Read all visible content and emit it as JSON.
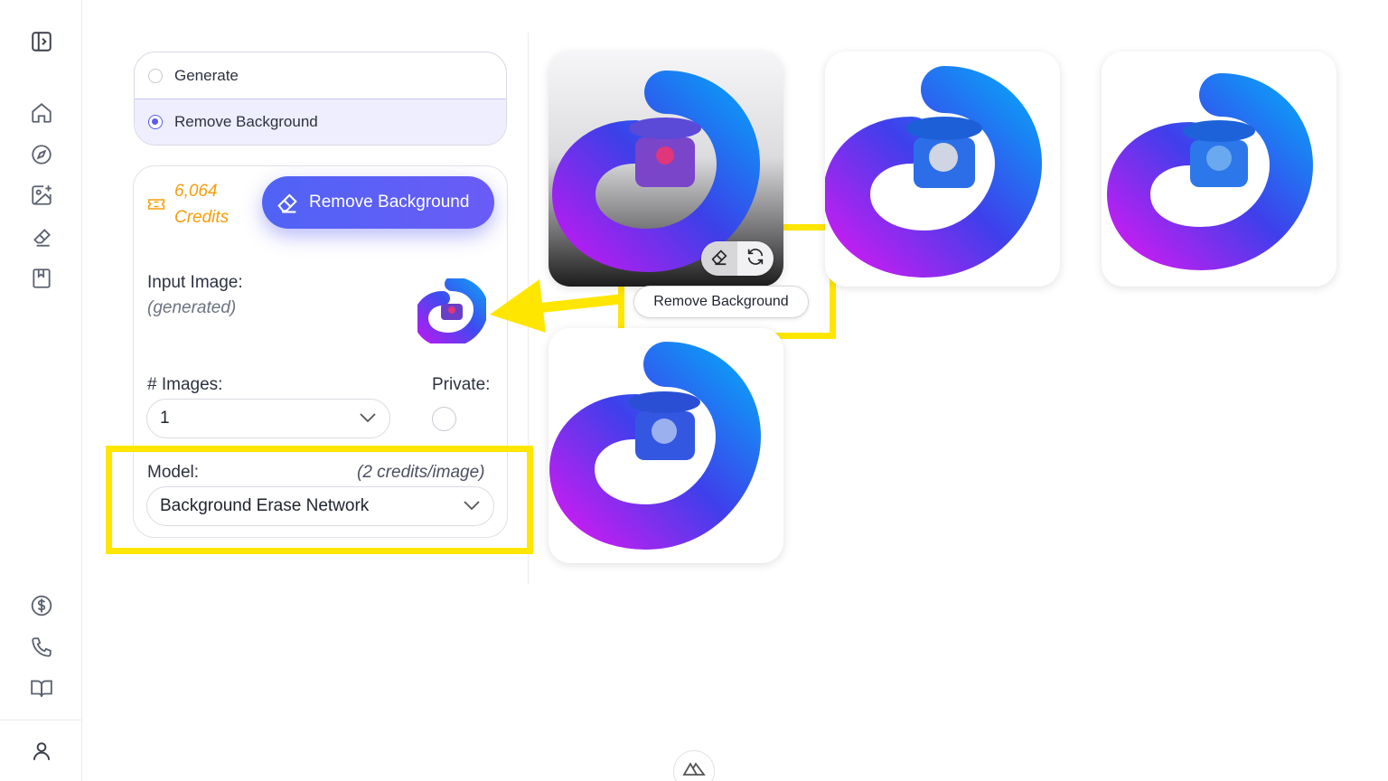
{
  "mode": {
    "options": [
      {
        "label": "Generate",
        "selected": false
      },
      {
        "label": "Remove Background",
        "selected": true
      }
    ]
  },
  "credits": {
    "amount": "6,064",
    "label": "Credits"
  },
  "action_button": {
    "label": "Remove Background"
  },
  "input_image": {
    "label": "Input Image:",
    "note": "(generated)"
  },
  "images_count": {
    "label": "# Images:",
    "value": "1"
  },
  "private": {
    "label": "Private:",
    "checked": false
  },
  "model": {
    "label": "Model:",
    "cost": "(2 credits/image)",
    "value": "Background Erase Network"
  },
  "tooltip": {
    "text": "Remove Background"
  },
  "colors": {
    "accent": "#5b5bf0",
    "credits": "#f59e0b",
    "highlight": "#ffe600"
  },
  "icons": [
    "sidebar-toggle-icon",
    "home-icon",
    "compass-icon",
    "image-add-icon",
    "eraser-icon",
    "bookmark-icon",
    "dollar-icon",
    "phone-icon",
    "book-icon",
    "user-icon",
    "ticket-icon",
    "refresh-icon",
    "logo-icon"
  ]
}
